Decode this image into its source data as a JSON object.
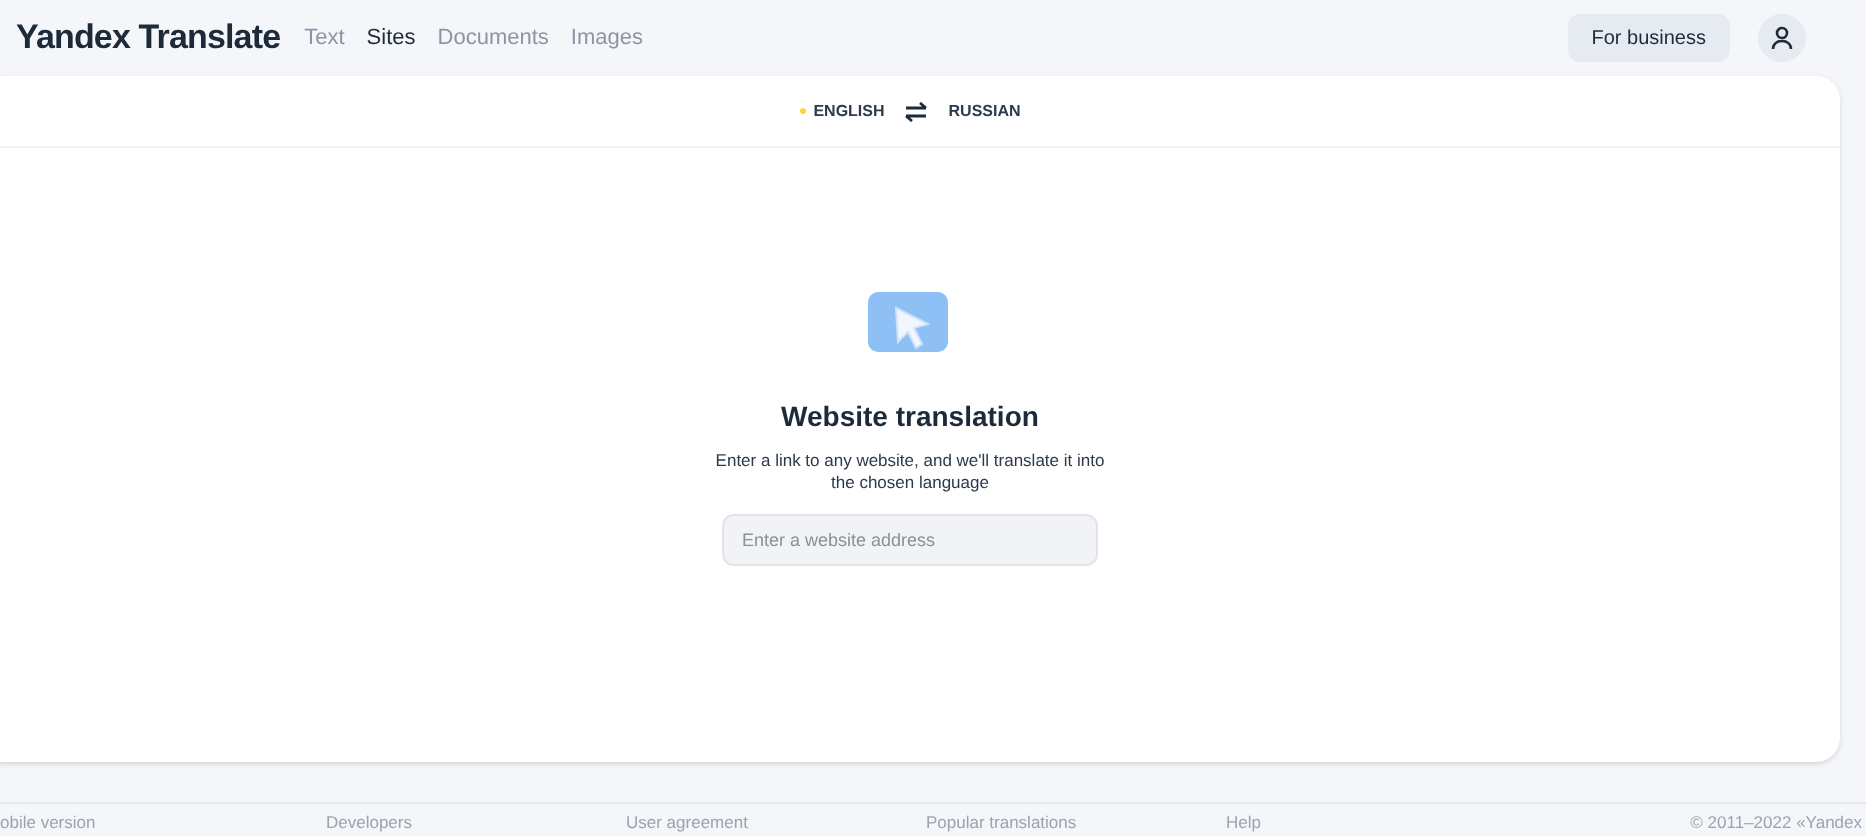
{
  "header": {
    "logo": "Yandex Translate",
    "tabs": [
      {
        "label": "Text",
        "selected": false
      },
      {
        "label": "Sites",
        "selected": true
      },
      {
        "label": "Documents",
        "selected": false
      },
      {
        "label": "Images",
        "selected": false
      }
    ],
    "business_button": "For business"
  },
  "languages": [
    {
      "label": "ENGLISH",
      "selected": true
    },
    {
      "label": "RUSSIAN",
      "selected": false
    }
  ],
  "main": {
    "title": "Website translation",
    "description": "Enter a link to any website, and we'll translate it into the chosen language",
    "input": {
      "placeholder": "Enter a website address"
    }
  },
  "footer": {
    "links": [
      "obile version",
      "Developers",
      "User agreement",
      "Popular translations",
      "Help"
    ],
    "copyright": "© 2011–2022 «Yandex"
  }
}
